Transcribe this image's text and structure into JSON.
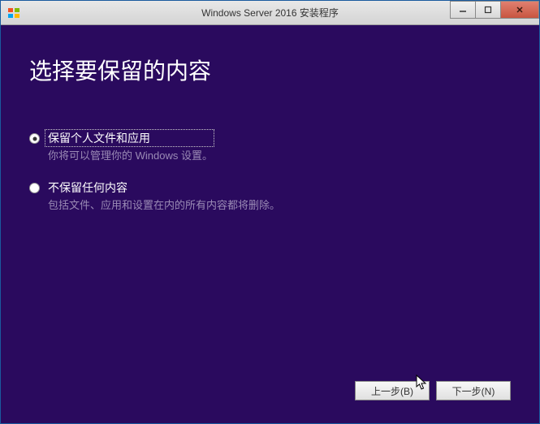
{
  "titlebar": {
    "title": "Windows Server 2016 安装程序"
  },
  "page": {
    "title": "选择要保留的内容"
  },
  "options": [
    {
      "label": "保留个人文件和应用",
      "description": "你将可以管理你的 Windows 设置。",
      "selected": true
    },
    {
      "label": "不保留任何内容",
      "description": "包括文件、应用和设置在内的所有内容都将删除。",
      "selected": false
    }
  ],
  "buttons": {
    "back": "上一步(B)",
    "next": "下一步(N)"
  }
}
